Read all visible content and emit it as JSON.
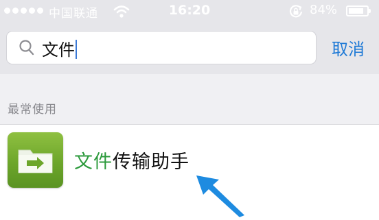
{
  "status_bar": {
    "carrier": "中国联通",
    "time": "16:20",
    "battery": "84%",
    "battery_level": 0.84,
    "icons": [
      "signal-dots-icon",
      "wifi-icon",
      "rotation-lock-icon",
      "battery-icon"
    ]
  },
  "search": {
    "query": "文件",
    "cancel_label": "取消",
    "icon": "search-icon"
  },
  "section": {
    "title": "最常使用"
  },
  "results": [
    {
      "highlight": "文件",
      "rest": "传输助手",
      "icon": "file-transfer-icon"
    }
  ],
  "colors": {
    "highlight": "#2c9a3c",
    "cancel": "#1f7ad6",
    "arrow": "#1e8be0",
    "app_icon": "#6da62b"
  }
}
